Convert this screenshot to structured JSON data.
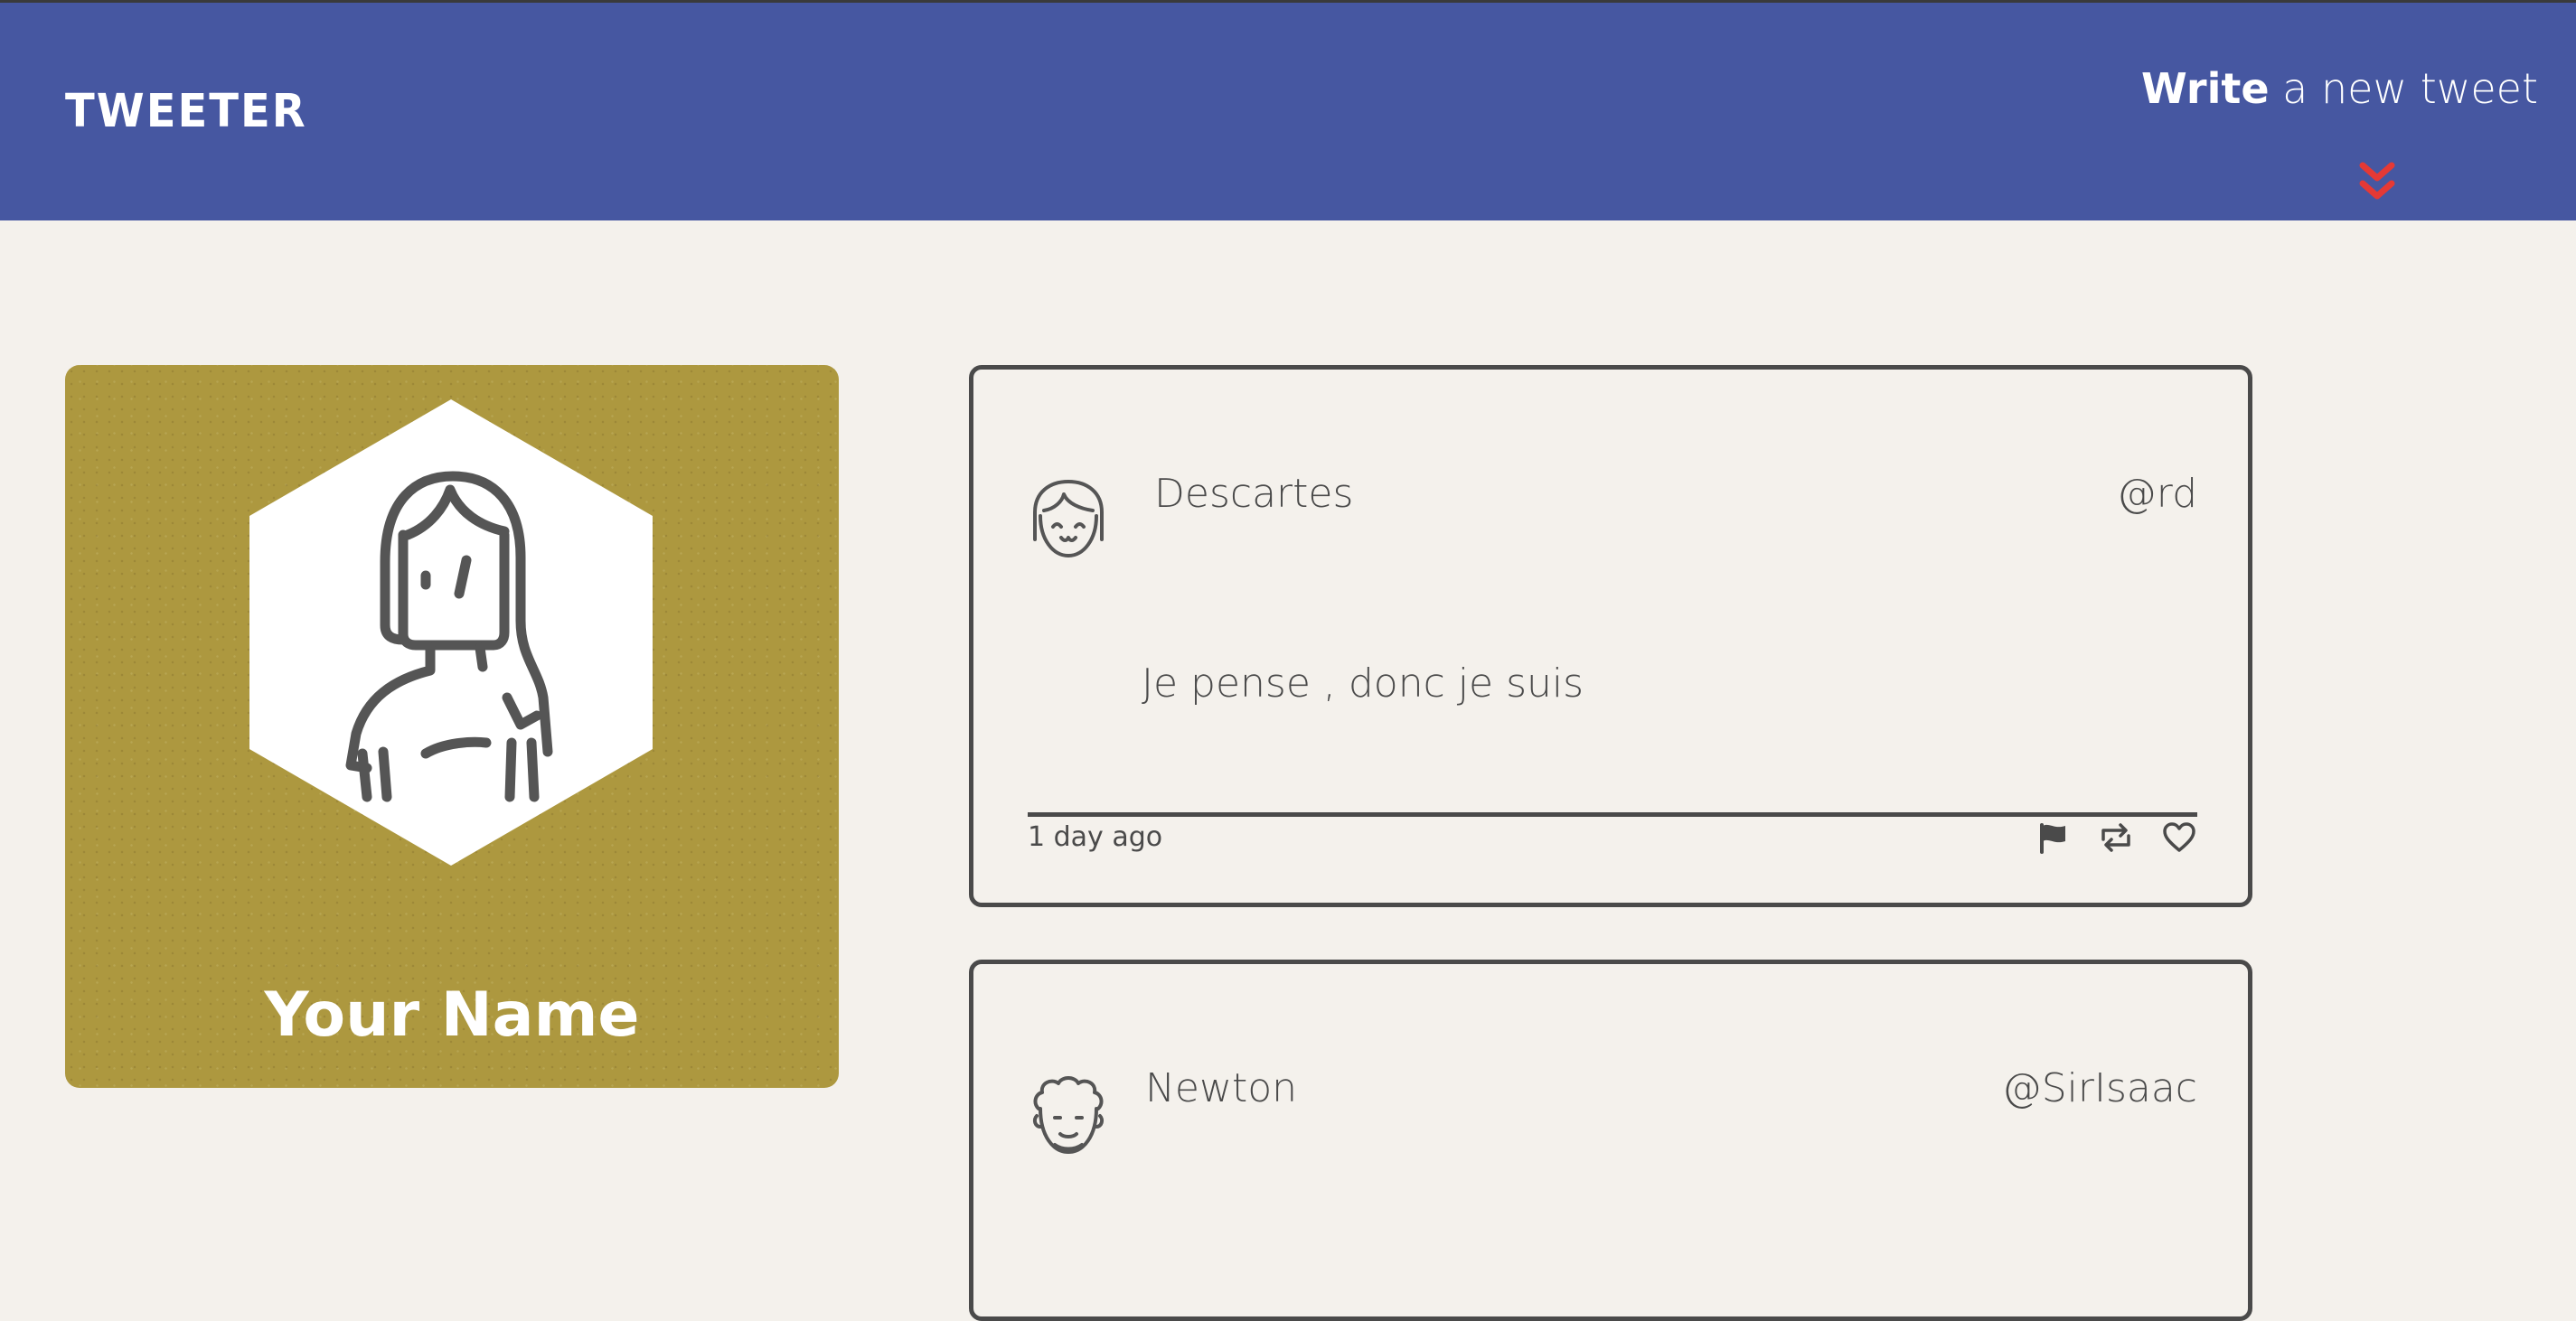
{
  "nav": {
    "logo": "TWEETER",
    "compose_bold": "Write",
    "compose_rest": " a new tweet",
    "compose_icon": "double-chevron-down-icon",
    "accent": "#e53935",
    "background": "#4657a1"
  },
  "profile": {
    "name": "Your Name",
    "background": "#ad983f"
  },
  "tweets": [
    {
      "name": "Descartes",
      "handle": "@rd",
      "text": "Je pense , donc je suis",
      "time": "1 day ago",
      "actions": [
        "flag-icon",
        "retweet-icon",
        "heart-icon"
      ]
    },
    {
      "name": "Newton",
      "handle": "@SirIsaac"
    }
  ]
}
